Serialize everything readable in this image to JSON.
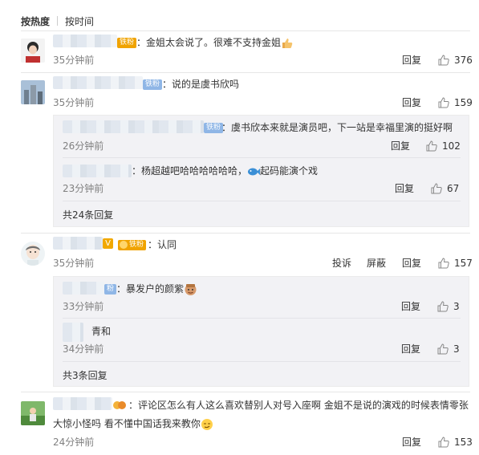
{
  "sort": {
    "hot": "按热度",
    "time": "按时间"
  },
  "comments": [
    {
      "badge": "铁粉",
      "text": "：金姐太会说了。很难不支持金姐",
      "time": "35分钟前",
      "reply": "回复",
      "likes": "376"
    },
    {
      "badge": "铁粉",
      "text": "：说的是虞书欣吗",
      "time": "35分钟前",
      "reply": "回复",
      "likes": "159",
      "sub": [
        {
          "badge": "铁粉",
          "text": "：虞书欣本来就是演员吧，下一站是幸福里演的挺好啊",
          "time": "26分钟前",
          "reply": "回复",
          "likes": "102"
        },
        {
          "text": "：杨超越吧哈哈哈哈哈哈，",
          "text2": "起码能演个戏",
          "time": "23分钟前",
          "reply": "回复",
          "likes": "67"
        }
      ],
      "more": "共24条回复"
    },
    {
      "badge": "铁粉",
      "text": "：认同",
      "time": "35分钟前",
      "report": "投诉",
      "block": "屏蔽",
      "reply": "回复",
      "likes": "157",
      "sub": [
        {
          "badge": "粉",
          "text": "：暴发户的颜紫",
          "time": "33分钟前",
          "reply": "回复",
          "likes": "3"
        },
        {
          "text": "青和",
          "time": "34分钟前",
          "reply": "回复",
          "likes": "3"
        }
      ],
      "more": "共3条回复"
    },
    {
      "line1": "：评论区怎么有人这么喜欢替别人对号入座啊 金姐不是说的演戏的时候表情零张",
      "line2": "大惊小怪吗 看不懂中国话我来教你",
      "time": "24分钟前",
      "reply": "回复",
      "likes": "153"
    }
  ],
  "icons": {
    "like": "thumbs-up-icon"
  },
  "colors": {
    "badge": "#f0a300",
    "link": "#333333",
    "muted": "#808080"
  }
}
